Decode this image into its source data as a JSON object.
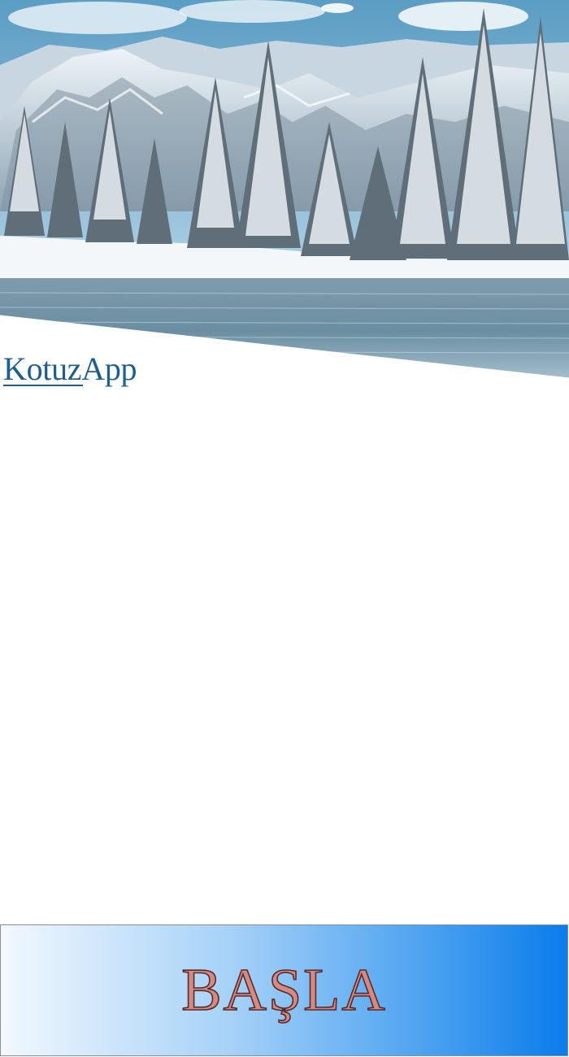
{
  "app": {
    "brand_part1": "Kotuz",
    "brand_part2": "App",
    "brand_color": "#1f5f8f"
  },
  "hero": {
    "image_subject": "snowy-mountain-forest-lake"
  },
  "start_button": {
    "label": "BAŞLA",
    "gradient": [
      "#f2f8fe",
      "#a7d2f8",
      "#4ca2f0",
      "#0a7ceb"
    ],
    "text_color": "#d38a83",
    "outline_color": "#5a2a2a"
  }
}
